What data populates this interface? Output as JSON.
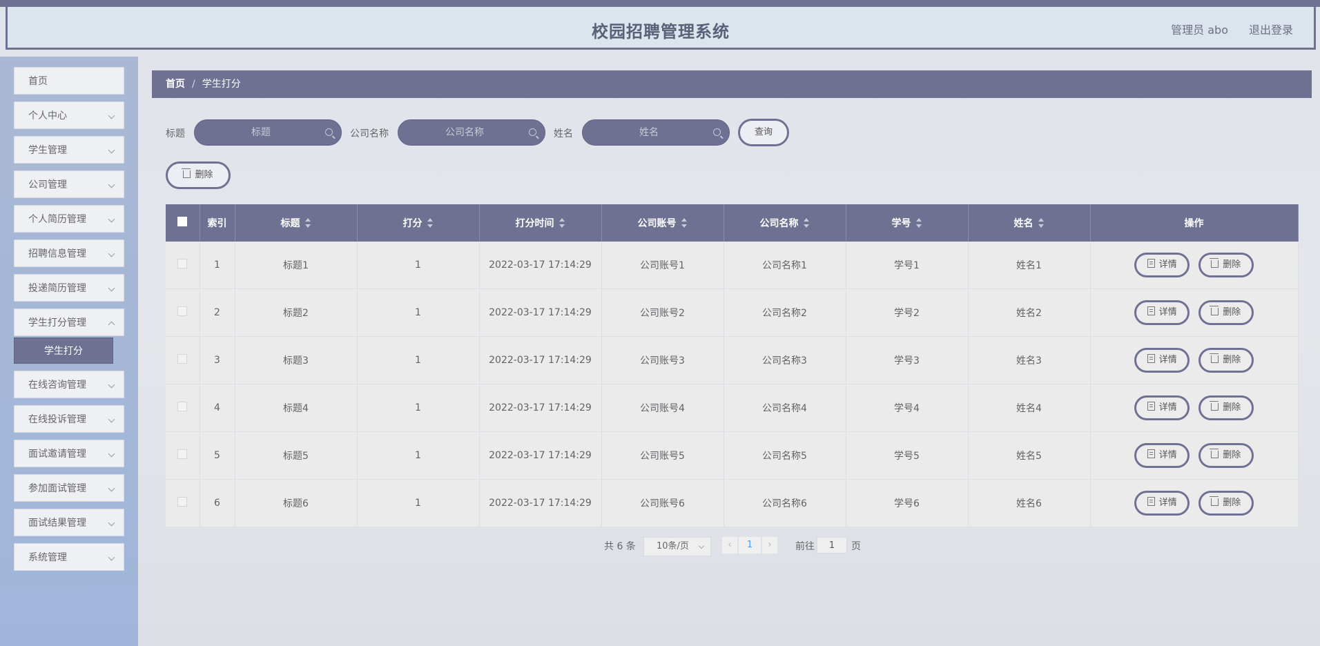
{
  "header": {
    "title": "校园招聘管理系统",
    "admin": "管理员 abo",
    "logout": "退出登录"
  },
  "sidebar": {
    "items": [
      {
        "label": "首页"
      },
      {
        "label": "个人中心"
      },
      {
        "label": "学生管理"
      },
      {
        "label": "公司管理"
      },
      {
        "label": "个人简历管理"
      },
      {
        "label": "招聘信息管理"
      },
      {
        "label": "投递简历管理"
      },
      {
        "label": "学生打分管理"
      },
      {
        "label": "在线咨询管理"
      },
      {
        "label": "在线投诉管理"
      },
      {
        "label": "面试邀请管理"
      },
      {
        "label": "参加面试管理"
      },
      {
        "label": "面试结果管理"
      },
      {
        "label": "系统管理"
      }
    ],
    "active_sub": "学生打分"
  },
  "breadcrumb": {
    "home": "首页",
    "separator": "/",
    "current": "学生打分"
  },
  "filters": {
    "title_label": "标题",
    "title_placeholder": "标题",
    "company_label": "公司名称",
    "company_placeholder": "公司名称",
    "name_label": "姓名",
    "name_placeholder": "姓名",
    "query_button": "查询"
  },
  "toolbar": {
    "delete_label": "删除"
  },
  "table": {
    "columns": [
      "索引",
      "标题",
      "打分",
      "打分时间",
      "公司账号",
      "公司名称",
      "学号",
      "姓名",
      "操作"
    ],
    "rows": [
      {
        "index": "1",
        "title": "标题1",
        "score": "1",
        "time": "2022-03-17 17:14:29",
        "account": "公司账号1",
        "company": "公司名称1",
        "sid": "学号1",
        "name": "姓名1"
      },
      {
        "index": "2",
        "title": "标题2",
        "score": "1",
        "time": "2022-03-17 17:14:29",
        "account": "公司账号2",
        "company": "公司名称2",
        "sid": "学号2",
        "name": "姓名2"
      },
      {
        "index": "3",
        "title": "标题3",
        "score": "1",
        "time": "2022-03-17 17:14:29",
        "account": "公司账号3",
        "company": "公司名称3",
        "sid": "学号3",
        "name": "姓名3"
      },
      {
        "index": "4",
        "title": "标题4",
        "score": "1",
        "time": "2022-03-17 17:14:29",
        "account": "公司账号4",
        "company": "公司名称4",
        "sid": "学号4",
        "name": "姓名4"
      },
      {
        "index": "5",
        "title": "标题5",
        "score": "1",
        "time": "2022-03-17 17:14:29",
        "account": "公司账号5",
        "company": "公司名称5",
        "sid": "学号5",
        "name": "姓名5"
      },
      {
        "index": "6",
        "title": "标题6",
        "score": "1",
        "time": "2022-03-17 17:14:29",
        "account": "公司账号6",
        "company": "公司名称6",
        "sid": "学号6",
        "name": "姓名6"
      }
    ],
    "detail_label": "详情",
    "delete_label": "删除"
  },
  "pagination": {
    "total": "共 6 条",
    "page_size": "10条/页",
    "prev": "‹",
    "current_page": "1",
    "next": "›",
    "goto_label": "前往",
    "goto_value": "1",
    "page_suffix": "页"
  },
  "colors": {
    "accent": "#6e7191",
    "active_page": "#409eff"
  }
}
